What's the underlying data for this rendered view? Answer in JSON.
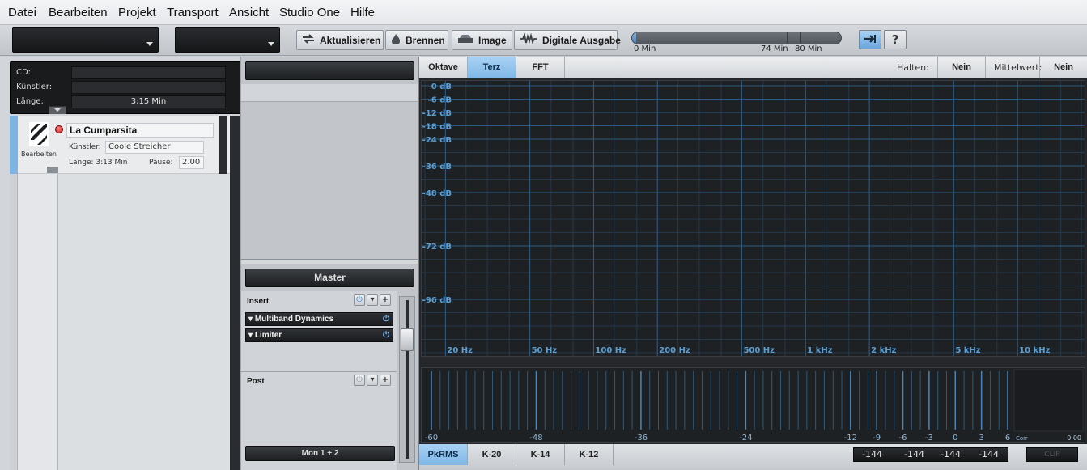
{
  "menu": [
    "Datei",
    "Bearbeiten",
    "Projekt",
    "Transport",
    "Ansicht",
    "Studio One",
    "Hilfe"
  ],
  "toolbar": {
    "update_label": "Aktualisieren",
    "burn_label": "Brennen",
    "image_label": "Image",
    "digital_label": "Digitale Ausgabe",
    "progress_fraction": 0.02,
    "progress_labels": [
      "0 Min",
      "74 Min",
      "80 Min"
    ],
    "help_label": "?",
    "accent": "#7fb6e6"
  },
  "cd": {
    "cd_label": "CD:",
    "artist_label": "Künstler:",
    "length_label": "Länge:",
    "cd_value": "",
    "artist_value": "",
    "length_value": "3:15 Min"
  },
  "track": {
    "edit_label": "Bearbeiten",
    "title": "La Cumparsita",
    "artist_label": "Künstler:",
    "artist": "Coole Streicher",
    "length": "Länge: 3:13 Min",
    "pause_label": "Pause:",
    "pause": "2.00",
    "record_color": "#e03030"
  },
  "mixer": {
    "master_label": "Master",
    "insert_label": "Insert",
    "post_label": "Post",
    "plugins": [
      "Multiband Dynamics",
      "Limiter"
    ],
    "output_label": "Mon 1 + 2"
  },
  "spectrum": {
    "tabs": [
      "Oktave",
      "Terz",
      "FFT"
    ],
    "active_tab": "Terz",
    "hold_label": "Halten:",
    "hold_value": "Nein",
    "average_label": "Mittelwert:",
    "average_value": "Nein",
    "db_labels": [
      "0 dB",
      "-6 dB",
      "-12 dB",
      "-18 dB",
      "-24 dB",
      "-36 dB",
      "-48 dB",
      "-72 dB",
      "-96 dB"
    ],
    "db_values": [
      0,
      -6,
      -12,
      -18,
      -24,
      -36,
      -48,
      -72,
      -96
    ],
    "freq_labels": [
      "20 Hz",
      "50 Hz",
      "100 Hz",
      "200 Hz",
      "500 Hz",
      "1 kHz",
      "2 kHz",
      "5 kHz",
      "10 kHz"
    ],
    "freq_values": [
      20,
      50,
      100,
      200,
      500,
      1000,
      2000,
      5000,
      10000
    ],
    "grid_color": "#2d5a80",
    "label_color": "#5a9fd4"
  },
  "meter": {
    "scale_labels": [
      "-60",
      "-48",
      "-36",
      "-24",
      "-12",
      "-9",
      "-6",
      "-3",
      "0",
      "3",
      "6"
    ],
    "scale_values": [
      -60,
      -48,
      -36,
      -24,
      -12,
      -9,
      -6,
      -3,
      0,
      3,
      6
    ],
    "corr_label": "Corr",
    "corr_value": "0.00",
    "modes": [
      "PkRMS",
      "K-20",
      "K-14",
      "K-12"
    ],
    "active_mode": "PkRMS",
    "readouts": [
      "-144",
      "-144",
      "-144",
      "-144"
    ],
    "clip_label": "CLIP"
  }
}
